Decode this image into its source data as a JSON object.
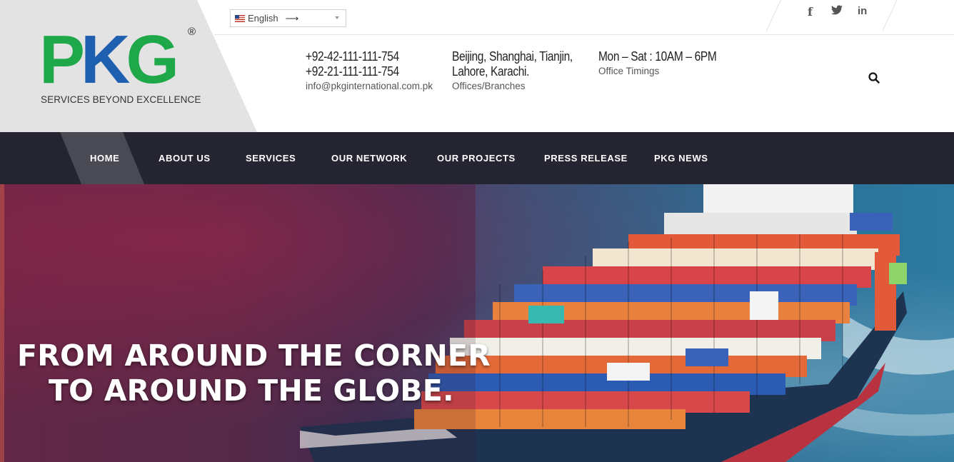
{
  "brand": {
    "letters": [
      "P",
      "K",
      "G"
    ],
    "registered": "®",
    "tagline": "SERVICES BEYOND EXCELLENCE",
    "colors": {
      "green": "#1fa84a",
      "blue": "#1f5fb0"
    }
  },
  "language": {
    "flag": "us-flag-icon",
    "label": "English",
    "arrow": "⟶"
  },
  "social": [
    "f",
    "t",
    "in"
  ],
  "contact": {
    "phone1": "+92-42-111-111-754",
    "phone2": "+92-21-111-111-754",
    "email": "info@pkginternational.com.pk"
  },
  "offices": {
    "line1": "Beijing, Shanghai, Tianjin,",
    "line2": "Lahore, Karachi.",
    "label": "Offices/Branches"
  },
  "timings": {
    "hours": "Mon – Sat : 10AM – 6PM",
    "label": "Office Timings"
  },
  "nav": {
    "items": [
      {
        "label": "HOME",
        "active": true
      },
      {
        "label": "ABOUT US"
      },
      {
        "label": "SERVICES"
      },
      {
        "label": "OUR NETWORK"
      },
      {
        "label": "OUR PROJECTS"
      },
      {
        "label": "PRESS RELEASE"
      },
      {
        "label": "PKG NEWS"
      }
    ]
  },
  "hero": {
    "line1": "FROM AROUND THE CORNER",
    "line2": "TO AROUND THE GLOBE."
  },
  "colors": {
    "nav_bg": "#252532",
    "nav_active": "#4a4a54",
    "header_panel": "#e3e3e3"
  }
}
